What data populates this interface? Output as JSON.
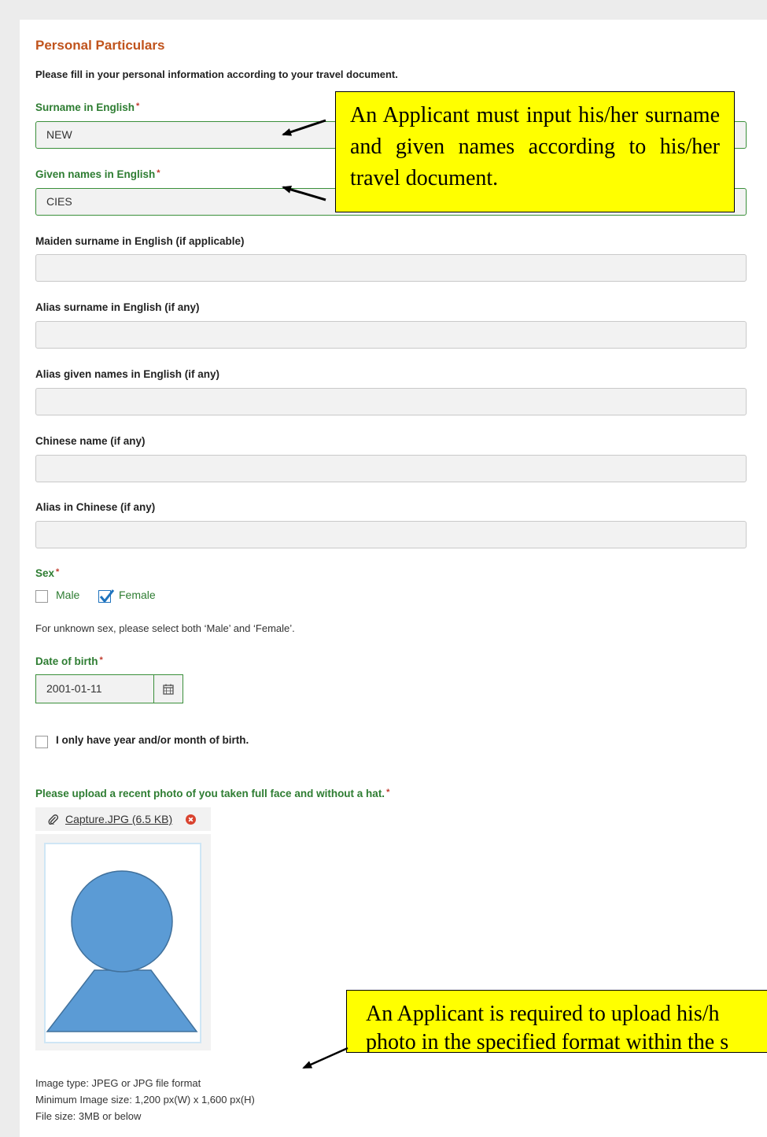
{
  "section": {
    "title": "Personal Particulars",
    "intro": "Please fill in your personal information according to your travel document."
  },
  "fields": {
    "surname": {
      "label": "Surname in English",
      "required_mark": "*",
      "value": "NEW"
    },
    "given_names": {
      "label": "Given names in English",
      "required_mark": "*",
      "value": "CIES"
    },
    "maiden_surname": {
      "label": "Maiden surname in English (if applicable)",
      "value": ""
    },
    "alias_surname": {
      "label": "Alias surname in English (if any)",
      "value": ""
    },
    "alias_given_names": {
      "label": "Alias given names in English (if any)",
      "value": ""
    },
    "chinese_name": {
      "label": "Chinese name (if any)",
      "value": ""
    },
    "alias_chinese": {
      "label": "Alias in Chinese (if any)",
      "value": ""
    }
  },
  "sex": {
    "label": "Sex",
    "required_mark": "*",
    "options": [
      {
        "label": "Male",
        "checked": false
      },
      {
        "label": "Female",
        "checked": true
      }
    ],
    "note": "For unknown sex, please select both ‘Male’ and ‘Female’."
  },
  "dob": {
    "label": "Date of birth",
    "required_mark": "*",
    "value": "2001-01-11",
    "calendar_icon": "calendar-icon",
    "partial_label": "I only have year and/or month of birth.",
    "partial_checked": false
  },
  "photo": {
    "label": "Please upload a recent photo of you taken full face and without a hat.",
    "required_mark": "*",
    "file_link": "Capture.JPG (6.5 KB)",
    "attach_icon": "paperclip-icon",
    "remove_icon": "remove-circle-icon",
    "requirements": [
      "Image type: JPEG or JPG file format",
      "Minimum Image size: 1,200 px(W) x 1,600 px(H)",
      "File size: 3MB or below"
    ]
  },
  "callouts": {
    "names": "An Applicant must input his/her surname and given names according to his/her travel document.",
    "photo_line1": "An Applicant is required to upload his/h",
    "photo_line2": "photo in the specified format within the s"
  },
  "colors": {
    "title": "#c0531c",
    "label_green": "#2e7d32",
    "required": "#c0392b",
    "callout_bg": "#ffff00",
    "avatar_fill": "#5b9bd5"
  }
}
